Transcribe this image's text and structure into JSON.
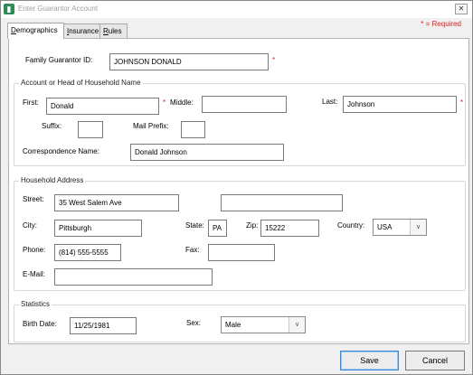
{
  "window": {
    "title": "Enter Guarantor Account",
    "close_glyph": "✕"
  },
  "required_note": "* = Required",
  "tabs": [
    {
      "label_u": "D",
      "label_rest": "emographics",
      "active": true
    },
    {
      "label_u": "I",
      "label_rest": "nsurance",
      "active": false
    },
    {
      "label_u": "R",
      "label_rest": "ules",
      "active": false
    }
  ],
  "guarantor": {
    "label": "Family Guarantor ID:",
    "value": "JOHNSON DONALD"
  },
  "account_group": {
    "title": "Account or Head of Household Name",
    "first_label": "First:",
    "first_value": "Donald",
    "middle_label": "Middle:",
    "middle_value": "",
    "last_label": "Last:",
    "last_value": "Johnson",
    "suffix_label": "Suffix:",
    "suffix_value": "",
    "mail_prefix_label": "Mail Prefix:",
    "mail_prefix_value": "",
    "correspondence_label": "Correspondence Name:",
    "correspondence_value": "Donald  Johnson"
  },
  "address_group": {
    "title": "Household Address",
    "street_label": "Street:",
    "street_value": "35 West Salem Ave",
    "street2_value": "",
    "city_label": "City:",
    "city_value": "Pittsburgh",
    "state_label": "State:",
    "state_value": "PA",
    "zip_label": "Zip:",
    "zip_value": "15222",
    "country_label": "Country:",
    "country_value": "USA",
    "phone_label": "Phone:",
    "phone_value": "(814) 555-5555",
    "fax_label": "Fax:",
    "fax_value": "",
    "email_label": "E-Mail:",
    "email_value": ""
  },
  "stats_group": {
    "title": "Statistics",
    "birth_label": "Birth Date:",
    "birth_value": "11/25/1981",
    "sex_label": "Sex:",
    "sex_value": "Male"
  },
  "buttons": {
    "save": "Save",
    "cancel": "Cancel"
  },
  "required_mark": "*",
  "dropdown_glyph": "∨",
  "icons": {
    "app": "app-icon",
    "close": "close-icon",
    "chevron": "chevron-down-icon"
  },
  "colors": {
    "required": "#e0201b",
    "accent": "#3b8ad9",
    "app_icon": "#2e8b57"
  }
}
